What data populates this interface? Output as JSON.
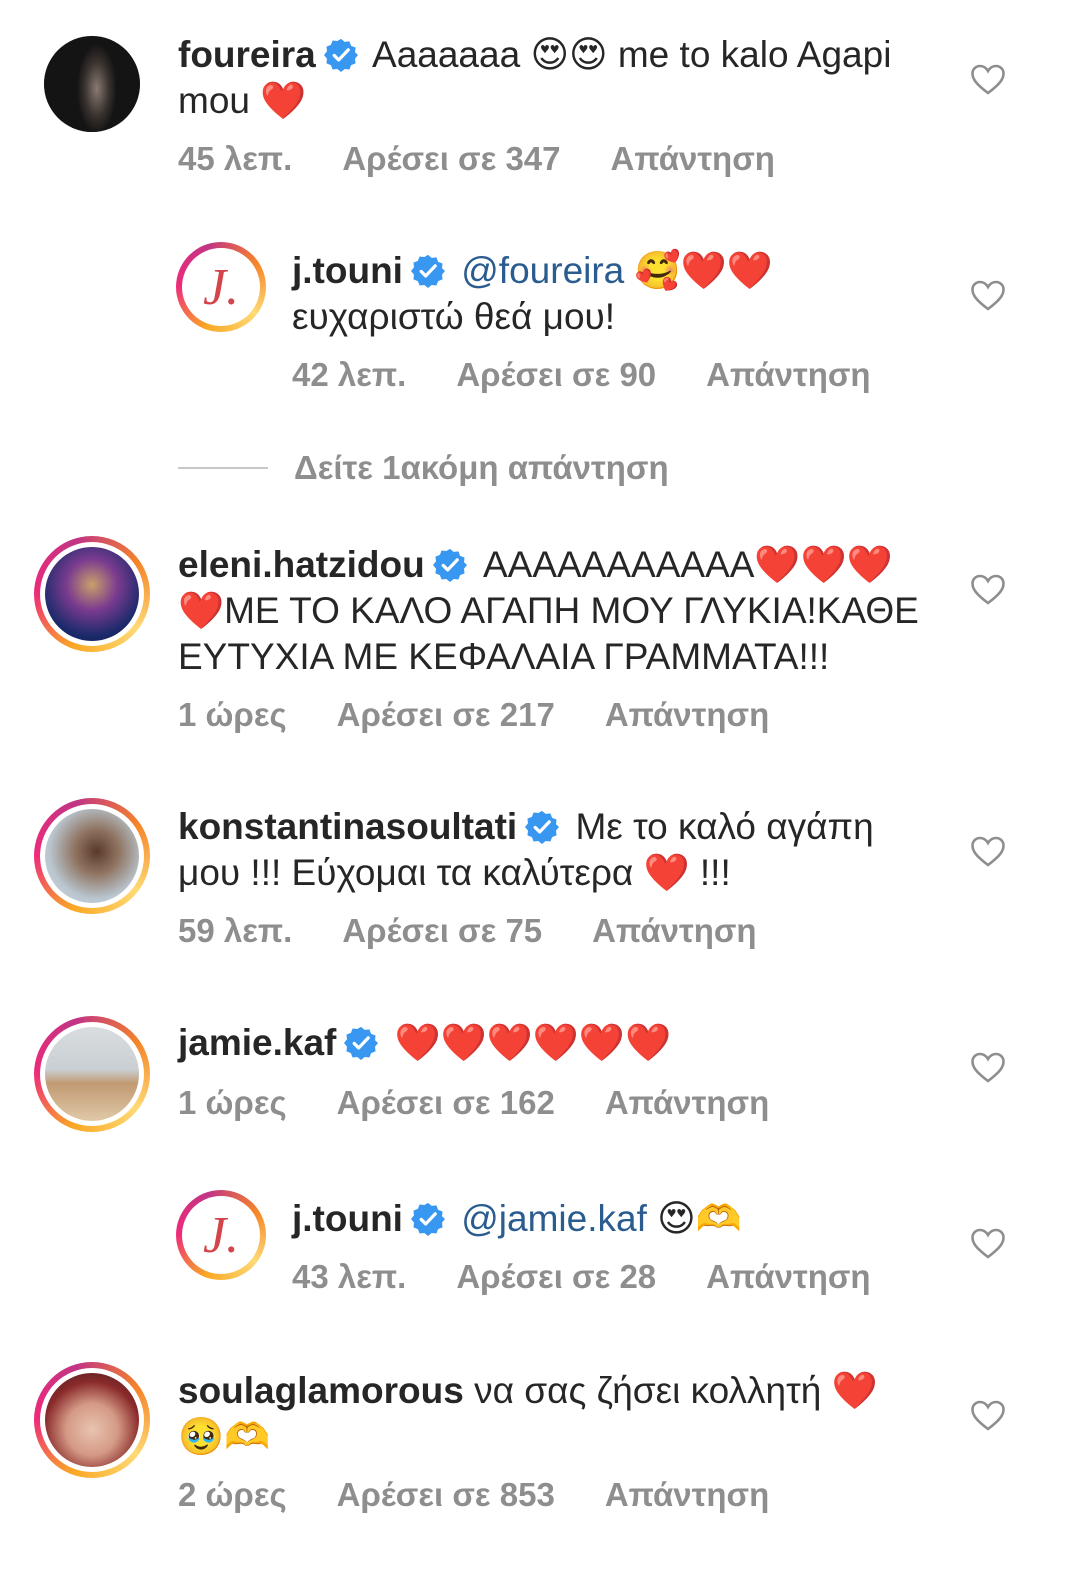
{
  "comments": [
    {
      "username": "foureira",
      "text": "Aaaaaaa 😍😍 me to kalo Agapi mou ❤️",
      "time": "45 λεπ.",
      "likes": "Αρέσει σε 347",
      "reply": "Απάντηση"
    },
    {
      "username": "j.touni",
      "mention": "@foureira",
      "text": "🥰❤️❤️",
      "text2": "ευχαριστώ θεά μου!",
      "time": "42 λεπ.",
      "likes": "Αρέσει σε 90",
      "reply": "Απάντηση"
    },
    {
      "username": "eleni.hatzidou",
      "text": "ΑΑΑΑΑΑΑΑΑΑΑ❤️❤️❤️❤️ΜΕ ΤΟ ΚΑΛΟ ΑΓΑΠΗ ΜΟΥ ΓΛΥΚΙΑ!ΚΑΘΕ ΕΥΤΥΧΙΑ ΜΕ ΚΕΦΑΛΑΙΑ ΓΡΑΜΜΑΤΑ!!!",
      "time": "1 ώρες",
      "likes": "Αρέσει σε 217",
      "reply": "Απάντηση"
    },
    {
      "username": "konstantinasoultati",
      "text": "Με το καλό αγάπη μου !!! Εύχομαι τα καλύτερα ❤️ !!!",
      "time": "59 λεπ.",
      "likes": "Αρέσει σε 75",
      "reply": "Απάντηση"
    },
    {
      "username": "jamie.kaf",
      "text": "❤️❤️❤️❤️❤️❤️",
      "time": "1 ώρες",
      "likes": "Αρέσει σε 162",
      "reply": "Απάντηση"
    },
    {
      "username": "j.touni",
      "mention": "@jamie.kaf",
      "text": "😍🫶",
      "time": "43 λεπ.",
      "likes": "Αρέσει σε 28",
      "reply": "Απάντηση"
    },
    {
      "username": "soulaglamorous",
      "text": "να σας ζήσει κολλητή ❤️ 🥹🫶",
      "time": "2 ώρες",
      "likes": "Αρέσει σε 853",
      "reply": "Απάντηση"
    }
  ],
  "more_replies": "Δείτε 1ακόμη απάντηση",
  "logo_letter": "J.",
  "colors": {
    "verified": "#3897f0",
    "mention": "#2a5c8f",
    "heart": "#e0245e"
  }
}
